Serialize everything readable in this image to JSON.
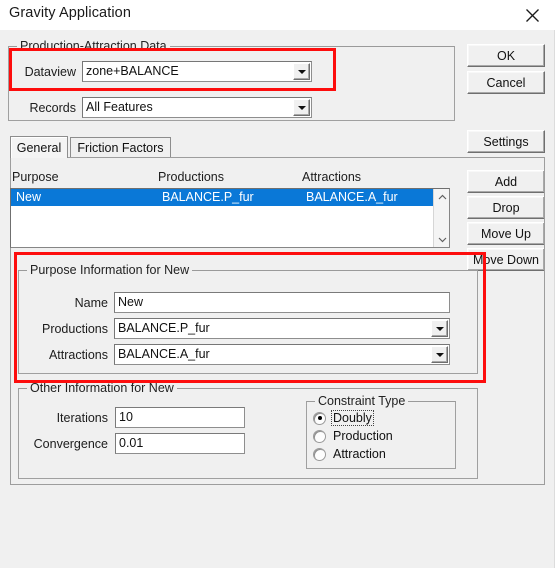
{
  "window": {
    "title": "Gravity Application",
    "close_icon": "close-icon"
  },
  "right_buttons": {
    "ok": "OK",
    "cancel": "Cancel",
    "settings": "Settings"
  },
  "list_buttons": {
    "add": "Add",
    "drop": "Drop",
    "move_up": "Move Up",
    "move_down": "Move Down"
  },
  "pa_group": {
    "legend": "Production-Attraction Data",
    "dataview_label": "Dataview",
    "dataview_value": "zone+BALANCE",
    "records_label": "Records",
    "records_value": "All Features",
    "dropdown_icon": "chevron-down-icon"
  },
  "tabs": [
    {
      "label": "General",
      "active": true
    },
    {
      "label": "Friction Factors",
      "active": false
    }
  ],
  "table": {
    "headers": [
      "Purpose",
      "Productions",
      "Attractions"
    ],
    "rows": [
      {
        "purpose": "New",
        "productions": "BALANCE.P_fur",
        "attractions": "BALANCE.A_fur",
        "selected": true
      }
    ],
    "scroll_up_icon": "chevron-up-icon",
    "scroll_down_icon": "chevron-down-icon"
  },
  "purpose_info": {
    "legend": "Purpose Information for New",
    "name_label": "Name",
    "name_value": "New",
    "productions_label": "Productions",
    "productions_value": "BALANCE.P_fur",
    "attractions_label": "Attractions",
    "attractions_value": "BALANCE.A_fur"
  },
  "other_info": {
    "legend": "Other Information for New",
    "iterations_label": "Iterations",
    "iterations_value": "10",
    "convergence_label": "Convergence",
    "convergence_value": "0.01"
  },
  "constraint": {
    "legend": "Constraint Type",
    "options": [
      {
        "label": "Doubly",
        "selected": true
      },
      {
        "label": "Production",
        "selected": false
      },
      {
        "label": "Attraction",
        "selected": false
      }
    ]
  },
  "annotations": {
    "color": "#fd0d0d",
    "count": 2
  }
}
